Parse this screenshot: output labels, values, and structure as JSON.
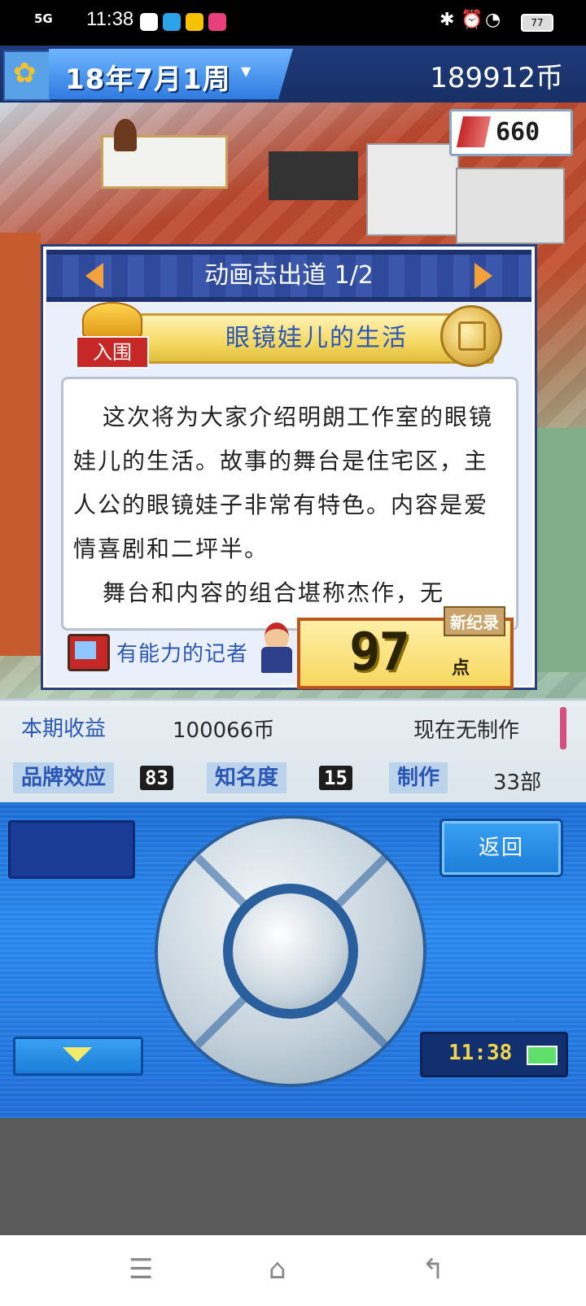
{
  "status_bar": {
    "network": "5G",
    "time": "11:38",
    "battery": "77"
  },
  "top_bar": {
    "date": "18年7月1周",
    "money": "189912币"
  },
  "counter_badge": {
    "value": "660"
  },
  "dialog": {
    "title": "动画志出道 1/2",
    "crown_tag": "入围",
    "work_title": "眼镜娃儿的生活",
    "paragraph_1": "这次将为大家介绍明朗工作室的眼镜娃儿的生活。故事的舞台是住宅区，主人公的眼镜娃子非常有特色。内容是爱情喜剧和二坪半。",
    "paragraph_2": "舞台和内容的组合堪称杰作，无",
    "reporter_label": "有能力的记者",
    "new_record": "新纪录",
    "score": "97",
    "score_unit": "点"
  },
  "stats": {
    "income_label": "本期收益",
    "income_value": "100066币",
    "production_status": "现在无制作",
    "brand_label": "品牌效应",
    "brand_value": "83",
    "fame_label": "知名度",
    "fame_value": "15",
    "works_label": "制作",
    "works_value": "33部"
  },
  "console": {
    "back_label": "返回",
    "clock": "11:38"
  }
}
